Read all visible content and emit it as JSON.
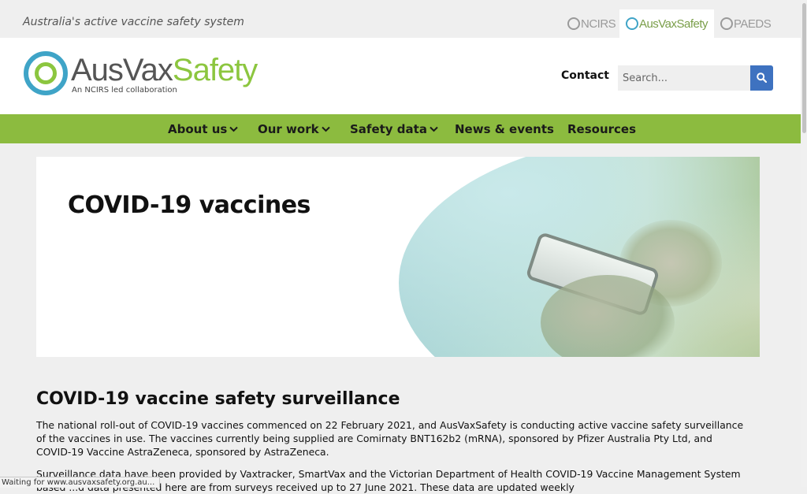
{
  "topbar": {
    "tagline": "Australia's active vaccine safety system",
    "network": [
      {
        "label": "NCIRS"
      },
      {
        "label": "AusVaxSafety"
      },
      {
        "label": "PAEDS"
      }
    ]
  },
  "header": {
    "logo": {
      "part1": "AusVax",
      "part2": "Safety",
      "subtitle": "An NCIRS led collaboration"
    },
    "contact_label": "Contact",
    "search": {
      "placeholder": "Search..."
    }
  },
  "nav": {
    "items": [
      {
        "label": "About us",
        "dropdown": true
      },
      {
        "label": "Our work",
        "dropdown": true
      },
      {
        "label": "Safety data",
        "dropdown": true
      },
      {
        "label": "News & events",
        "dropdown": false
      },
      {
        "label": "Resources",
        "dropdown": false
      }
    ]
  },
  "hero": {
    "title": "COVID-19 vaccines"
  },
  "main": {
    "heading": "COVID-19 vaccine safety surveillance",
    "paragraph1": "The national roll-out of COVID-19 vaccines commenced on 22 February 2021, and AusVaxSafety is conducting active vaccine safety surveillance of the vaccines in use. The vaccines currently being supplied are Comirnaty BNT162b2 (mRNA), sponsored by Pfizer Australia Pty Ltd, and COVID-19 Vaccine AstraZeneca, sponsored by AstraZeneca.",
    "paragraph2": "Surveillance data have been provided by Vaxtracker, SmartVax and the Victorian Department of Health COVID-19 Vaccine Management System based ...d data presented here are from surveys received up to 27 June 2021. These data are updated weekly"
  },
  "status": {
    "text": "Waiting for www.ausvaxsafety.org.au..."
  },
  "colors": {
    "brand_green": "#8cbb3f",
    "brand_blue": "#3fa4c7",
    "search_button": "#3e72c0"
  }
}
